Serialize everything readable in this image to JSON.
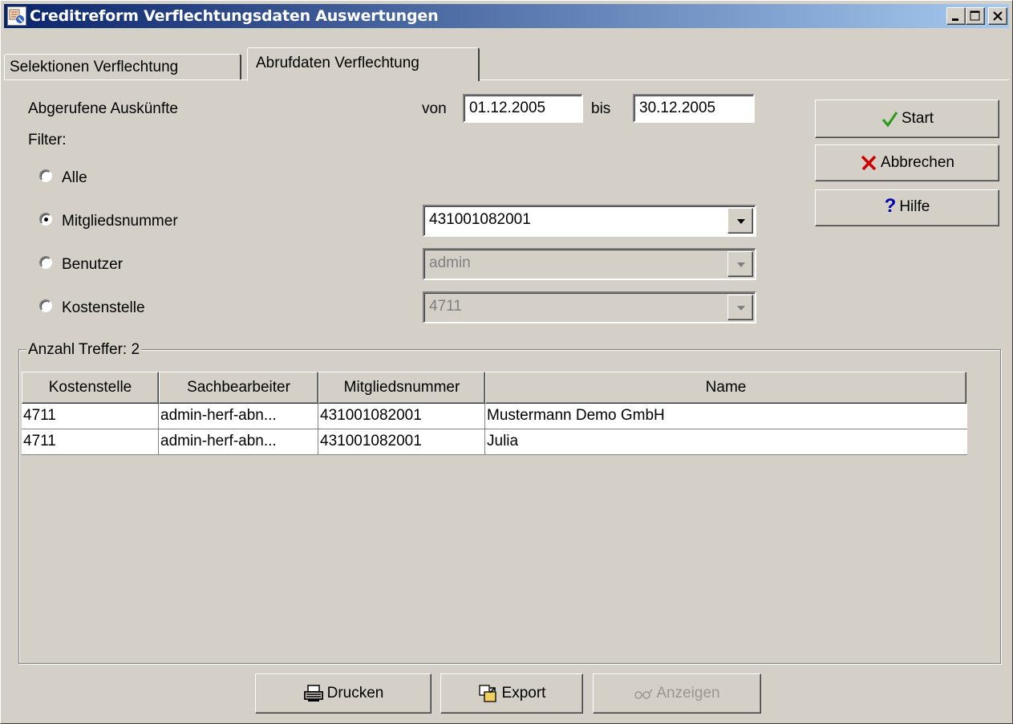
{
  "window": {
    "title": "Creditreform Verflechtungsdaten Auswertungen",
    "titlebar_color_start": "#0a246a",
    "titlebar_color_end": "#a6caf0"
  },
  "tabs": [
    {
      "label": "Selektionen Verflechtung",
      "active": false
    },
    {
      "label": "Abrufdaten Verflechtung",
      "active": true
    }
  ],
  "form": {
    "section_label": "Abgerufene Auskünfte",
    "von_label": "von",
    "von_value": "01.12.2005",
    "bis_label": "bis",
    "bis_value": "30.12.2005",
    "filter_label": "Filter:",
    "radios": [
      {
        "label": "Alle",
        "checked": false
      },
      {
        "label": "Mitgliedsnummer",
        "checked": true
      },
      {
        "label": "Benutzer",
        "checked": false
      },
      {
        "label": "Kostenstelle",
        "checked": false
      }
    ],
    "mitgliedsnummer_value": "431001082001",
    "benutzer_value": "admin",
    "kostenstelle_value": "4711"
  },
  "side_buttons": {
    "start": "Start",
    "abbrechen": "Abbrechen",
    "hilfe": "Hilfe"
  },
  "results": {
    "group_title": "Anzahl Treffer: 2",
    "columns": [
      "Kostenstelle",
      "Sachbearbeiter",
      "Mitgliedsnummer",
      "Name"
    ],
    "rows": [
      [
        "4711",
        "admin-herf-abn...",
        "431001082001",
        "Mustermann Demo GmbH"
      ],
      [
        "4711",
        "admin-herf-abn...",
        "431001082001",
        "Julia"
      ]
    ]
  },
  "bottom_buttons": {
    "drucken": "Drucken",
    "export": "Export",
    "anzeigen": "Anzeigen"
  },
  "colors": {
    "face": "#d4d0c8",
    "check_green": "#2a9a1a",
    "cancel_red": "#cc0000",
    "help_blue": "#0000aa"
  }
}
